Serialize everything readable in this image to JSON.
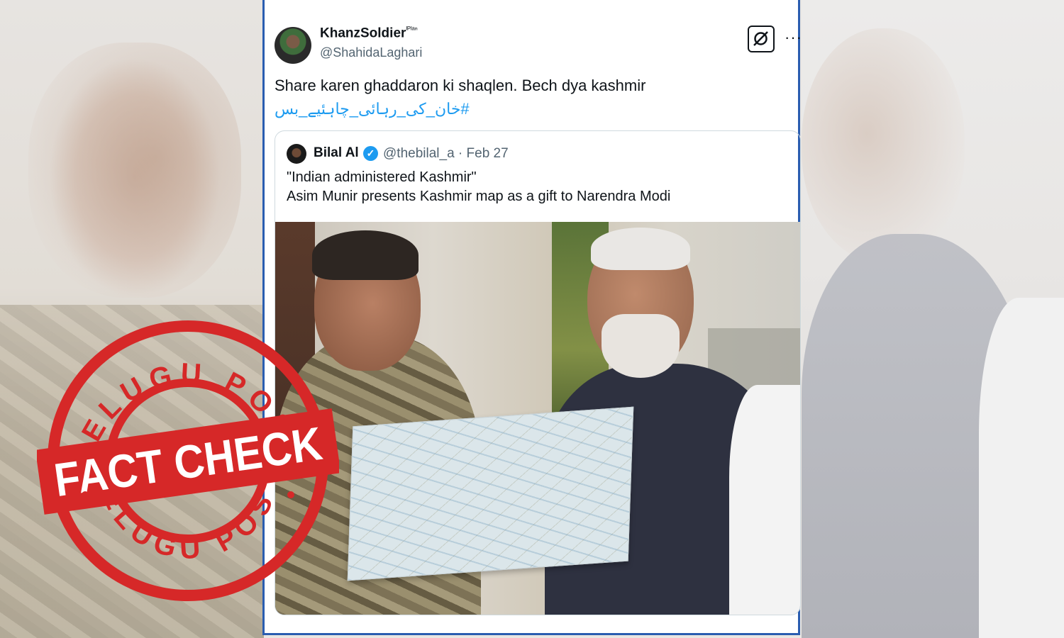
{
  "post": {
    "display_name": "KhanzSoldier",
    "display_name_suffix": "ᴵᴾᴵᵃⁿ",
    "handle": "@ShahidaLaghari",
    "more_label": "···",
    "text": "Share karen ghaddaron ki shaqlen. Bech dya kashmir",
    "hashtag": "#خان_کی_رہائی_چاہئیے_بس"
  },
  "quoted_post": {
    "display_name": "Bilal Al",
    "verified_glyph": "✓",
    "handle_date": "@thebilal_a · Feb 27",
    "line1": "\"Indian administered Kashmir\"",
    "line2": "Asim Munir presents Kashmir map as a gift to Narendra Modi"
  },
  "stamp": {
    "top_text": "TELUGU POST",
    "center_text": "FACT CHECK",
    "bottom_text": "TELUGU POST",
    "color": "#d62828"
  },
  "colors": {
    "card_border": "#2a5db0",
    "link": "#1d9bf0",
    "text": "#0f1419",
    "muted": "#536471"
  },
  "icons": {
    "grok": "grok-icon",
    "more": "more-options-icon",
    "verified": "verified-badge-icon"
  }
}
